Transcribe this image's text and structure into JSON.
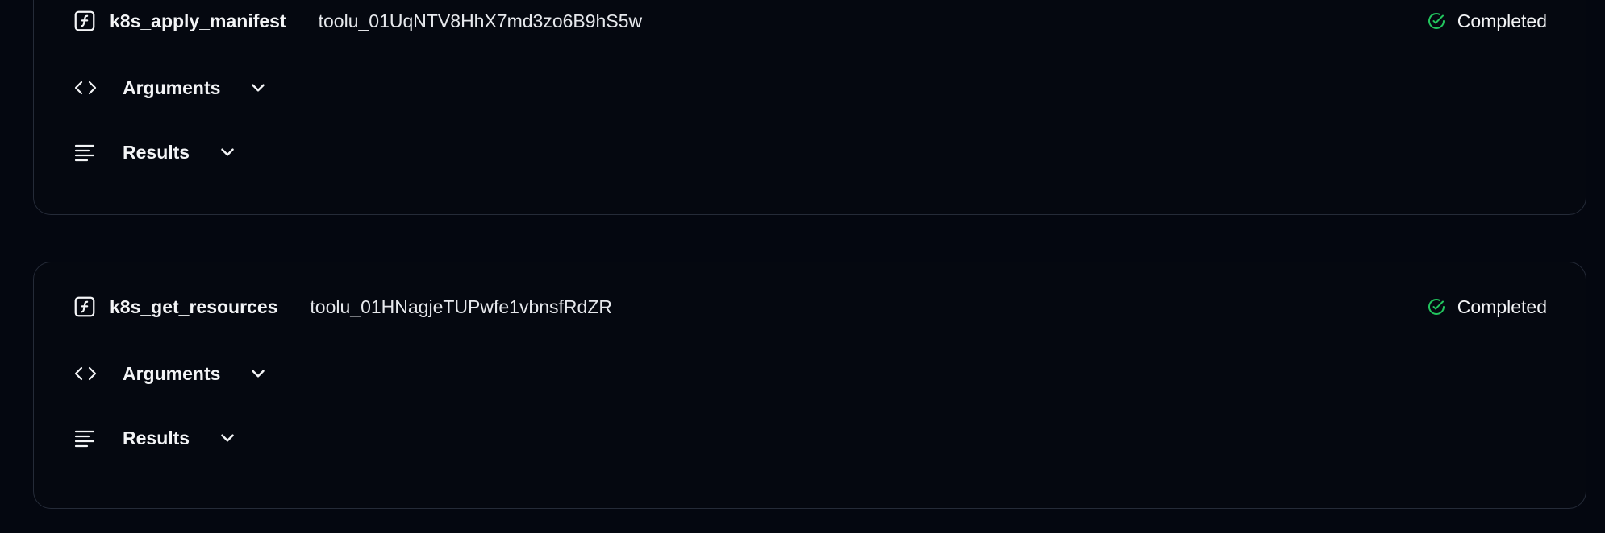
{
  "theme": {
    "background": "#040710",
    "card_border": "#252b38",
    "success": "#22c55e",
    "text": "#f3f4f6"
  },
  "tool_calls": [
    {
      "name": "k8s_apply_manifest",
      "id": "toolu_01UqNTV8HhX7md3zo6B9hS5w",
      "status": "Completed",
      "arguments_label": "Arguments",
      "results_label": "Results"
    },
    {
      "name": "k8s_get_resources",
      "id": "toolu_01HNagjeTUPwfe1vbnsfRdZR",
      "status": "Completed",
      "arguments_label": "Arguments",
      "results_label": "Results"
    }
  ],
  "icons": {
    "function": "function-icon",
    "status": "check-circle-icon",
    "arguments": "code-brackets-icon",
    "results": "text-lines-icon",
    "expand": "chevron-down-icon"
  }
}
